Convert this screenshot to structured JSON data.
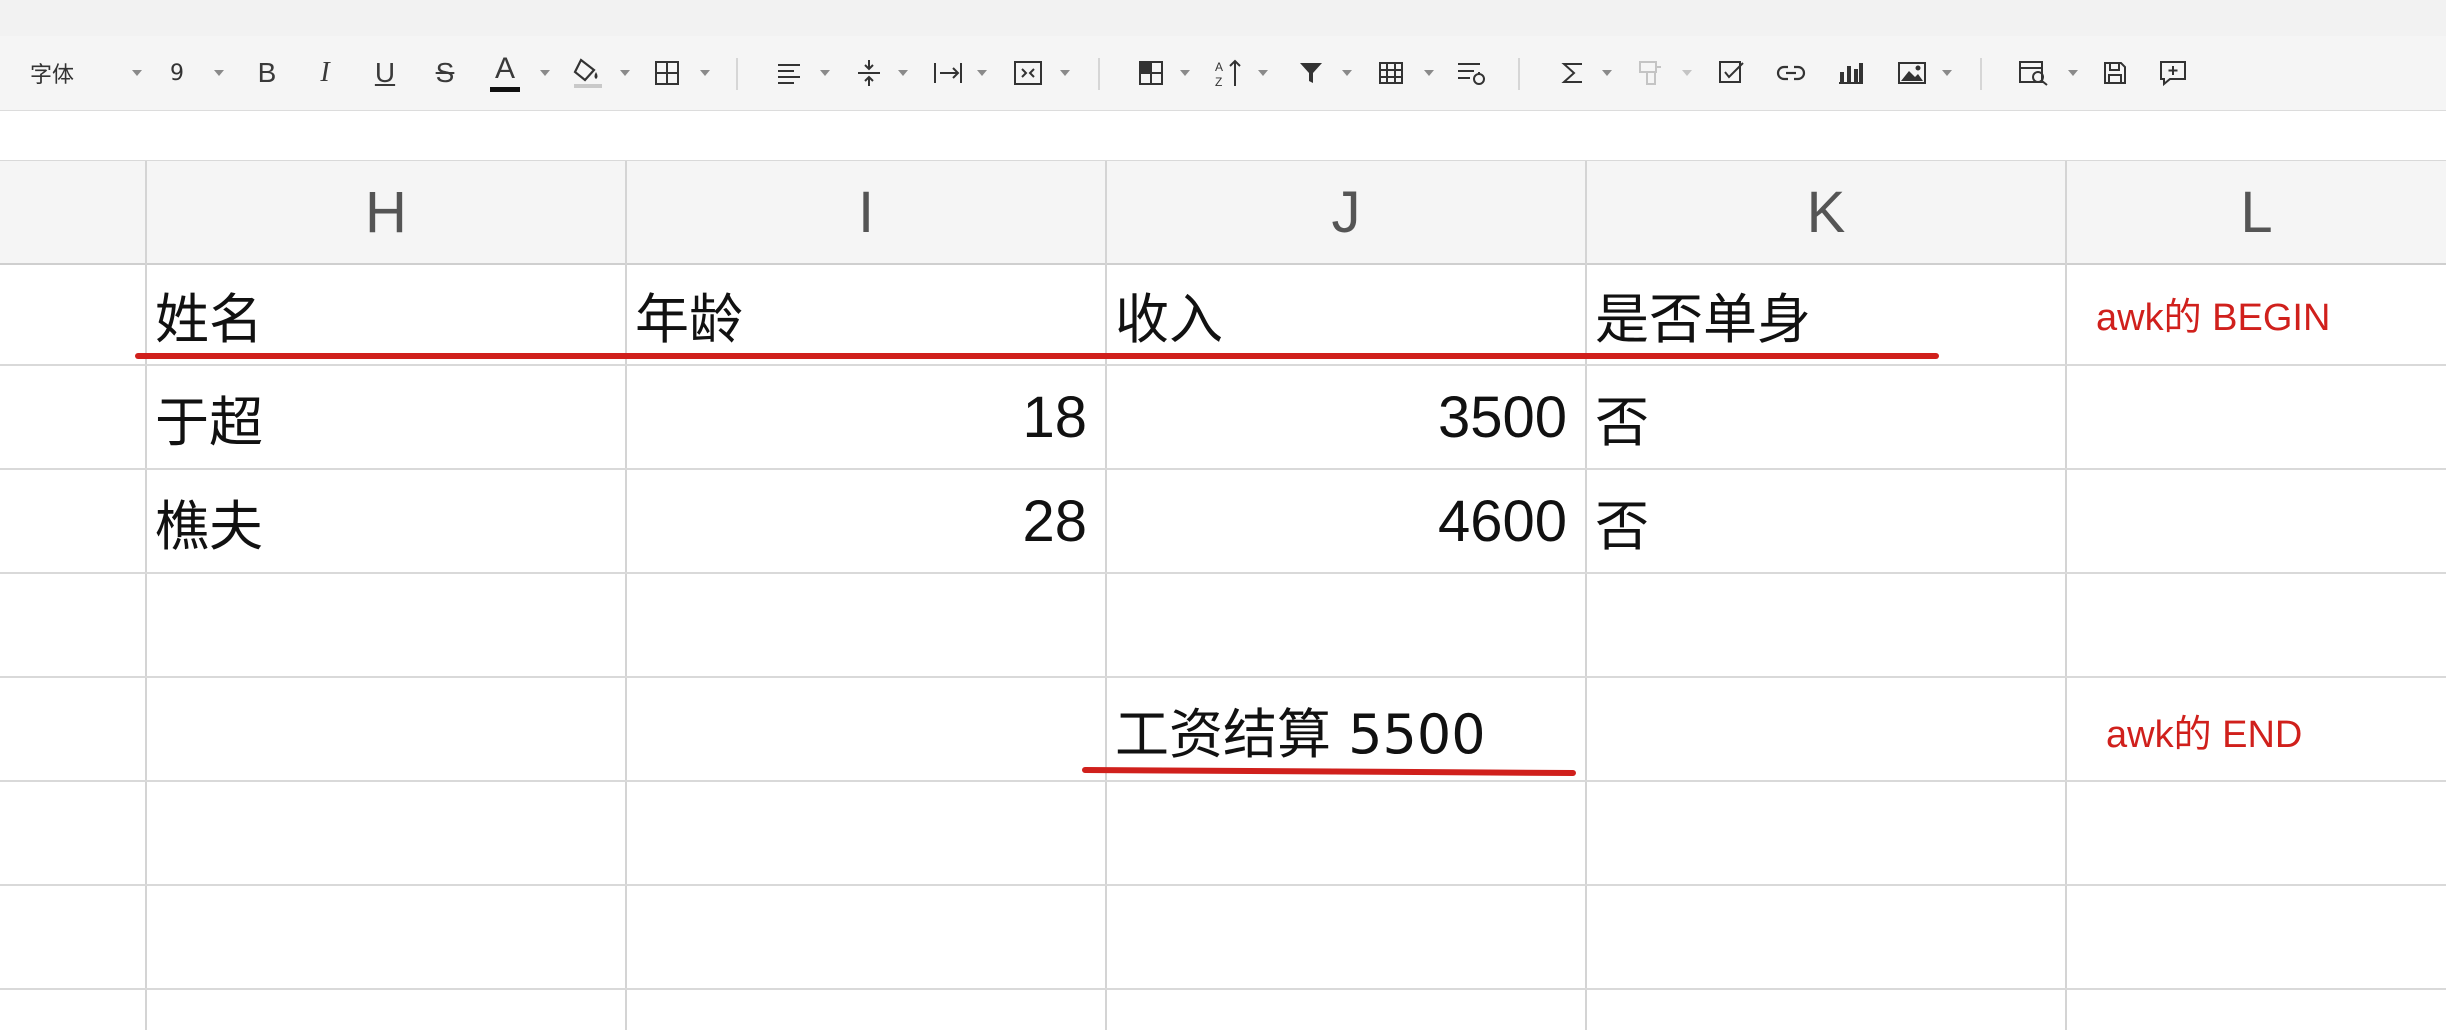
{
  "toolbar": {
    "font_name": "字体",
    "font_size": "9",
    "bold": "B",
    "italic": "I",
    "underline": "U",
    "strike": "S",
    "font_color_letter": "A"
  },
  "columns": [
    "H",
    "I",
    "J",
    "K",
    "L"
  ],
  "rows": [
    {
      "H": "姓名",
      "I": "年龄",
      "J": "收入",
      "K": "是否单身",
      "L": "awk的 BEGIN"
    },
    {
      "H": "于超",
      "I": "18",
      "J": "3500",
      "K": "否",
      "L": ""
    },
    {
      "H": "樵夫",
      "I": "28",
      "J": "4600",
      "K": "否",
      "L": ""
    },
    {
      "H": "",
      "I": "",
      "J": "",
      "K": "",
      "L": ""
    },
    {
      "H": "",
      "I": "",
      "J": "工资结算 5500",
      "K": "",
      "L": "awk的 END"
    },
    {
      "H": "",
      "I": "",
      "J": "",
      "K": "",
      "L": ""
    },
    {
      "H": "",
      "I": "",
      "J": "",
      "K": "",
      "L": ""
    }
  ],
  "colors": {
    "annotation": "#d0201c",
    "font_color_bar": "#111111"
  }
}
